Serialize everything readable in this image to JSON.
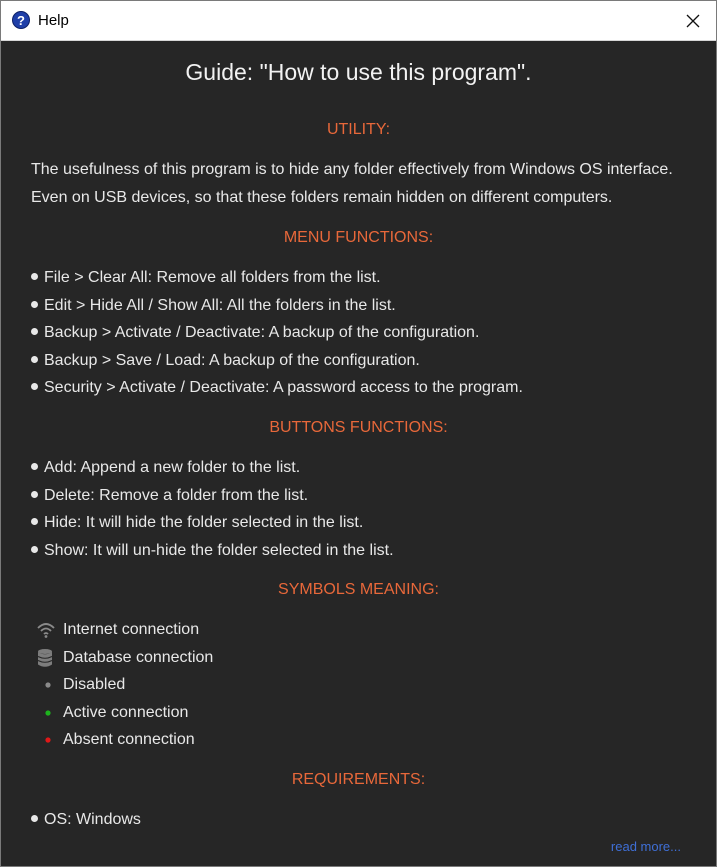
{
  "window": {
    "title": "Help"
  },
  "guide_title": "Guide: \"How to use this program\".",
  "utility": {
    "heading": "UTILITY:",
    "lines": [
      "The usefulness of this program is to hide any folder effectively from Windows OS interface.",
      "Even on USB devices, so that these folders remain hidden on different computers."
    ]
  },
  "menu_functions": {
    "heading": "MENU FUNCTIONS:",
    "items": [
      "File > Clear All: Remove all folders from the list.",
      "Edit > Hide All / Show All: All the folders in the list.",
      "Backup > Activate / Deactivate: A backup of the configuration.",
      "Backup > Save / Load: A backup of the configuration.",
      "Security > Activate / Deactivate: A password access to the program."
    ]
  },
  "buttons_functions": {
    "heading": "BUTTONS FUNCTIONS:",
    "items": [
      "Add: Append a new folder to the list.",
      "Delete: Remove a folder from the list.",
      "Hide: It will hide the folder selected in the list.",
      "Show: It will un-hide the folder selected in the list."
    ]
  },
  "symbols_meaning": {
    "heading": "SYMBOLS MEANING:",
    "items": [
      {
        "icon": "wifi-icon",
        "label": "Internet connection",
        "color": "#8a8a8a"
      },
      {
        "icon": "database-icon",
        "label": "Database connection",
        "color": "#8a8a8a"
      },
      {
        "icon": "grey-dot-icon",
        "label": "Disabled",
        "color": "#8a8a8a"
      },
      {
        "icon": "green-dot-icon",
        "label": "Active connection",
        "color": "#1db31d"
      },
      {
        "icon": "red-dot-icon",
        "label": "Absent connection",
        "color": "#e01818"
      }
    ]
  },
  "requirements": {
    "heading": "REQUIREMENTS:",
    "items": [
      "OS: Windows"
    ]
  },
  "read_more": "read more..."
}
